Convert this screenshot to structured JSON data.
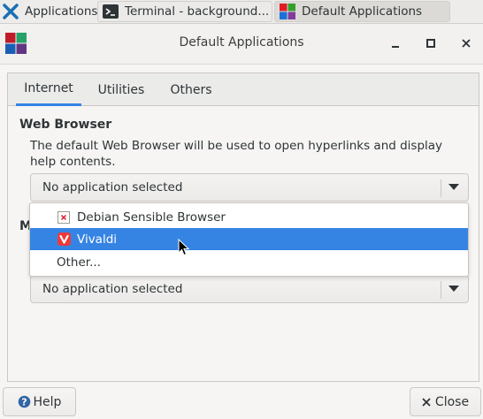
{
  "taskbar": {
    "applications_label": "Applications",
    "terminal_label": "Terminal - background...",
    "default_apps_label": "Default Applications"
  },
  "window": {
    "title": "Default Applications"
  },
  "tabs": [
    {
      "label": "Internet",
      "active": true
    },
    {
      "label": "Utilities",
      "active": false
    },
    {
      "label": "Others",
      "active": false
    }
  ],
  "web_browser": {
    "title": "Web Browser",
    "description": "The default Web Browser will be used to open hyperlinks and display help contents.",
    "selected": "No application selected"
  },
  "mail_reader": {
    "title_visible": "M",
    "selected": "No application selected"
  },
  "dropdown": {
    "items": [
      {
        "label": "Debian Sensible Browser",
        "icon": "debian-sensible-browser-icon",
        "selected": false
      },
      {
        "label": "Vivaldi",
        "icon": "vivaldi-icon",
        "selected": true
      },
      {
        "label": "Other...",
        "icon": "",
        "selected": false
      }
    ]
  },
  "footer": {
    "help_label": "Help",
    "close_label": "Close"
  },
  "colors": {
    "accent": "#3584e4",
    "vivaldi": "#ef3939"
  }
}
